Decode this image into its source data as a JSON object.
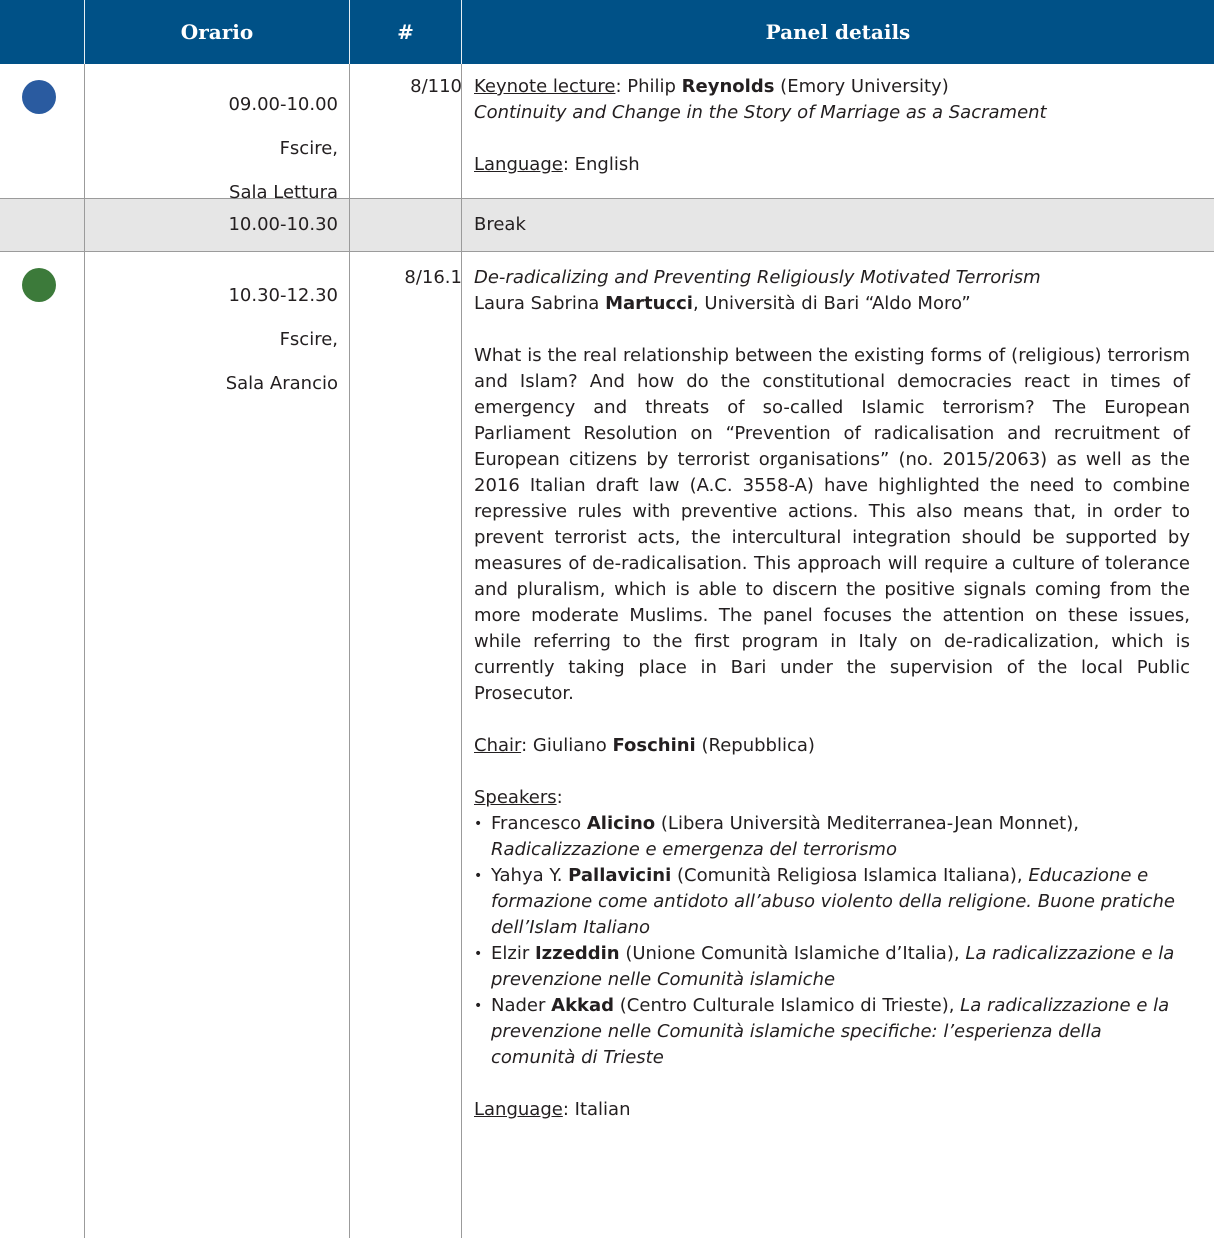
{
  "header": {
    "col_orario": "Orario",
    "col_num": "#",
    "col_details": "Panel details"
  },
  "colors": {
    "header_bg": "#005187",
    "break_bg": "#e6e6e6",
    "dot_blue": "#2a5ba0",
    "dot_green": "#3c7a3a"
  },
  "rows": [
    {
      "time": "09.00-10.00",
      "place1": "Fscire,",
      "place2": "Sala Lettura",
      "num": "8/110",
      "lecture_label": "Keynote lecture",
      "lecture_first": "Philip",
      "lecture_last": "Reynolds",
      "lecture_affil": "(Emory University)",
      "title": "Continuity and Change in the Story of Marriage as a Sacrament",
      "language_label": "Language",
      "language": "English"
    },
    {
      "time": "10.00-10.30",
      "label": "Break"
    },
    {
      "time": "10.30-12.30",
      "place1": "Fscire,",
      "place2": "Sala Arancio",
      "num": "8/16.1",
      "title": "De-radicalizing and Preventing Religiously Motivated Terrorism",
      "author_first": "Laura Sabrina",
      "author_last": "Martucci",
      "author_affil": ", Università di Bari “Aldo Moro”",
      "abstract": "What is the real relationship between the existing forms of (religious) terrorism and Islam? And how do the constitutional democracies react in times of emergency and threats of so-called Islamic terrorism? The European Parliament Resolution on “Prevention of radicalisation and recruitment of European citizens by terrorist organisations” (no. 2015/2063) as well as the 2016 Italian draft law (A.C. 3558-A) have highlighted the need to combine repressive rules with preventive actions. This also means that, in order to prevent terrorist acts, the intercultural integration should be supported by measures of de-radicalisation. This approach will require a culture of tolerance and pluralism, which is able to discern the positive signals coming from the more moderate Muslims. The panel focuses the attention on these issues, while referring to the first program in Italy on de-radicalization, which is currently taking place in Bari under the supervision of the local Public Prosecutor.",
      "chair_label": "Chair",
      "chair_first": "Giuliano",
      "chair_last": "Foschini",
      "chair_affil": "(Repubblica)",
      "speakers_label": "Speakers",
      "speakers": [
        {
          "first": "Francesco",
          "last": "Alicino",
          "affil": "(Libera Università Mediterranea-Jean Monnet),",
          "title": "Radicalizzazione e emergenza del terrorismo"
        },
        {
          "first": "Yahya Y.",
          "last": "Pallavicini",
          "affil": "(Comunità Religiosa Islamica Italiana),",
          "title": "Educazione e formazione come antidoto all’abuso violento della religione. Buone pratiche dell’Islam Italiano"
        },
        {
          "first": "Elzir",
          "last": "Izzeddin",
          "affil": "(Unione Comunità Islamiche d’Italia),",
          "title": "La radicalizzazione e la prevenzione nelle Comunità islamiche"
        },
        {
          "first": "Nader",
          "last": "Akkad",
          "affil": "(Centro Culturale Islamico di Trieste),",
          "title": "La radicalizzazione e la prevenzione nelle Comunità islamiche specifiche: l’esperienza della comunità di Trieste"
        }
      ],
      "language_label": "Language",
      "language": "Italian"
    }
  ]
}
